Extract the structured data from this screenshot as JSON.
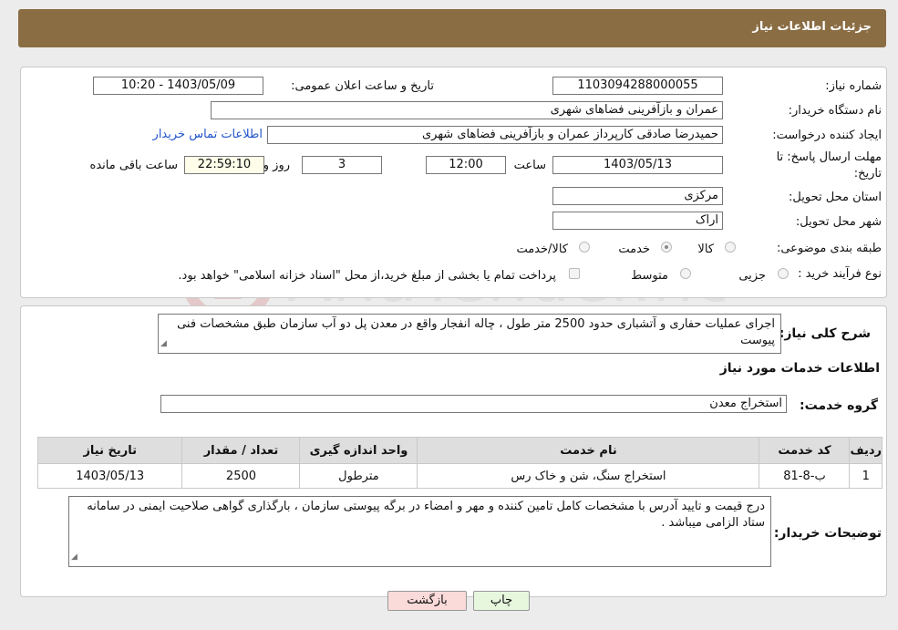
{
  "header": {
    "title": "جزئیات اطلاعات نیاز"
  },
  "need_info": {
    "need_number_label": "شماره نیاز:",
    "need_number": "1103094288000055",
    "announce_label": "تاریخ و ساعت اعلان عمومی:",
    "announce_value": "1403/05/09 - 10:20",
    "buyer_org_label": "نام دستگاه خریدار:",
    "buyer_org": "عمران و بازآفرینی فضاهای شهری",
    "requester_label": "ایجاد کننده درخواست:",
    "requester": "حمیدرضا    صادقی  کارپرداز  عمران و بازآفرینی فضاهای شهری",
    "contact_link": "اطلاعات تماس خریدار",
    "deadline_label_1": "مهلت ارسال پاسخ: تا",
    "deadline_label_2": "تاریخ:",
    "deadline_date": "1403/05/13",
    "time_label": "ساعت",
    "deadline_time": "12:00",
    "days_value": "3",
    "days_label": "روز و",
    "remaining_time": "22:59:10",
    "remaining_label": "ساعت باقی مانده",
    "province_label": "استان محل تحویل:",
    "province": "مرکزی",
    "city_label": "شهر محل تحویل:",
    "city": "اراک",
    "category_label": "طبقه بندی موضوعی:",
    "category_options": [
      "کالا",
      "خدمت",
      "کالا/خدمت"
    ],
    "category_selected": "خدمت",
    "process_label": "نوع فرآیند خرید :",
    "process_options": [
      "جزیی",
      "متوسط"
    ],
    "payment_note": "پرداخت تمام یا بخشی از مبلغ خرید،از محل \"اسناد خزانه اسلامی\" خواهد بود."
  },
  "description": {
    "summary_label": "شرح کلی نیاز:",
    "summary": "اجرای عملیات حفاری و آتشباری حدود 2500 متر طول ، چاله انفجار واقع در معدن پل دو آب سازمان طبق مشخصات فنی پیوست",
    "services_heading": "اطلاعات خدمات مورد نیاز",
    "service_group_label": "گروه خدمت:",
    "service_group": "استخراج معدن"
  },
  "table": {
    "headers": [
      "ردیف",
      "کد خدمت",
      "نام خدمت",
      "واحد اندازه گیری",
      "تعداد / مقدار",
      "تاریخ نیاز"
    ],
    "rows": [
      [
        "1",
        "ب-8-81",
        "استخراج سنگ، شن و خاک رس",
        "مترطول",
        "2500",
        "1403/05/13"
      ]
    ]
  },
  "buyer_notes": {
    "label": "توضیحات خریدار:",
    "text": "درج قیمت و تایید آدرس با مشخصات کامل تامین کننده و مهر و امضاء در برگه پیوستی سازمان ، بارگذاری گواهی صلاحیت ایمنی در سامانه ستاد الزامی میباشد ."
  },
  "buttons": {
    "print": "چاپ",
    "back": "بازگشت"
  },
  "colors": {
    "header_bg": "#8a6d43",
    "link": "#2255cc",
    "back_button": "#fbdada",
    "print_button": "#e6f7de"
  }
}
